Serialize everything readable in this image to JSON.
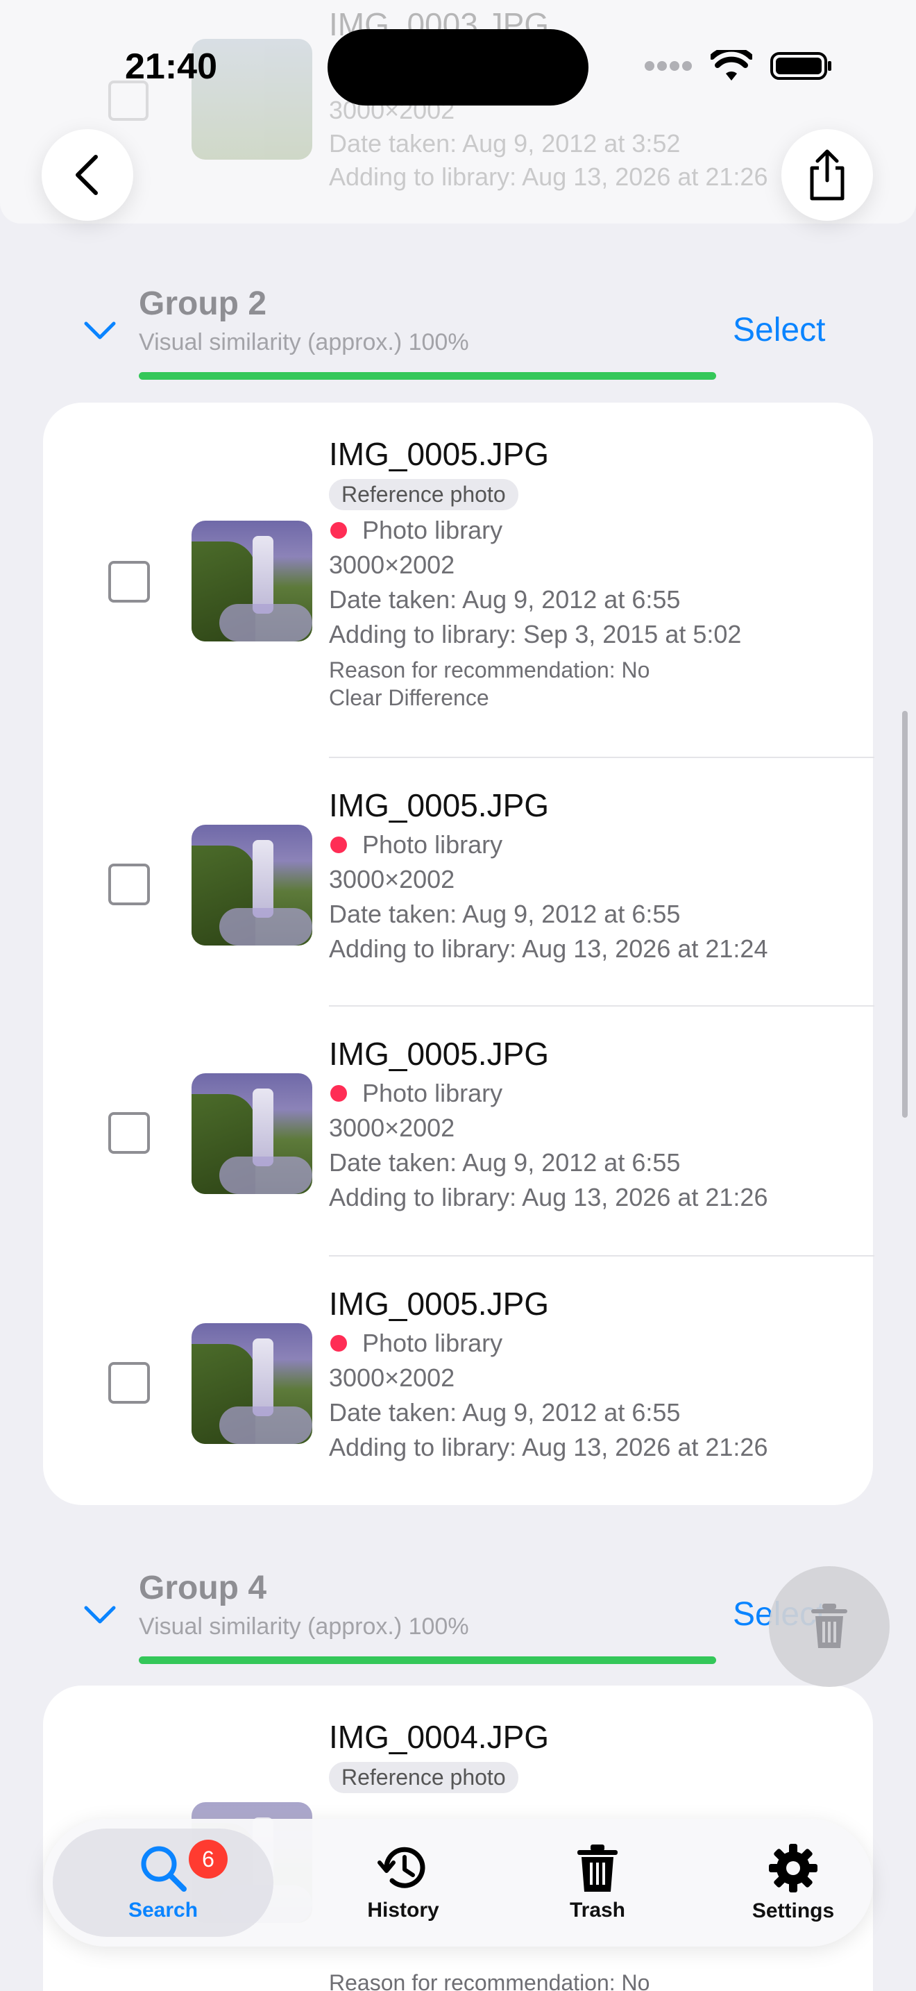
{
  "status_bar": {
    "time": "21:40"
  },
  "top_partial": {
    "filename": "IMG_0003.JPG",
    "dimensions": "3000×2002",
    "date_taken": "Date taken: Aug 9, 2012 at 3:52",
    "adding": "Adding to library: Aug 13, 2026 at 21:26"
  },
  "group2": {
    "title": "Group 2",
    "similarity": "Visual similarity (approx.) 100%",
    "similarity_value": 1.0,
    "select_label": "Select",
    "items": [
      {
        "filename": "IMG_0005.JPG",
        "badge": "Reference photo",
        "source": "Photo library",
        "dimensions": "3000×2002",
        "date_taken": "Date taken: Aug 9, 2012 at 6:55",
        "adding": "Adding to library: Sep 3, 2015 at 5:02",
        "reason_line1": "Reason for recommendation: No",
        "reason_line2": "Clear Difference"
      },
      {
        "filename": "IMG_0005.JPG",
        "source": "Photo library",
        "dimensions": "3000×2002",
        "date_taken": "Date taken: Aug 9, 2012 at 6:55",
        "adding": "Adding to library: Aug 13, 2026 at 21:24"
      },
      {
        "filename": "IMG_0005.JPG",
        "source": "Photo library",
        "dimensions": "3000×2002",
        "date_taken": "Date taken: Aug 9, 2012 at 6:55",
        "adding": "Adding to library: Aug 13, 2026 at 21:26"
      },
      {
        "filename": "IMG_0005.JPG",
        "source": "Photo library",
        "dimensions": "3000×2002",
        "date_taken": "Date taken: Aug 9, 2012 at 6:55",
        "adding": "Adding to library: Aug 13, 2026 at 21:26"
      }
    ]
  },
  "group4": {
    "title": "Group 4",
    "similarity": "Visual similarity (approx.) 100%",
    "similarity_value": 1.0,
    "select_label": "Select",
    "first_item": {
      "filename": "IMG_0004.JPG",
      "badge": "Reference photo",
      "reason_line1": "Reason for recommendation: No"
    }
  },
  "tabbar": {
    "tabs": [
      {
        "label": "Search",
        "icon": "magnifier-icon",
        "active": true,
        "badge": "6"
      },
      {
        "label": "History",
        "icon": "clock-history-icon",
        "active": false
      },
      {
        "label": "Trash",
        "icon": "trash-icon",
        "active": false
      },
      {
        "label": "Settings",
        "icon": "gear-icon",
        "active": false
      }
    ]
  },
  "colors": {
    "accent": "#0a84ff",
    "similarity_bar": "#34c759",
    "source_dot": "#ff2d55",
    "badge_red": "#ff3b30"
  }
}
